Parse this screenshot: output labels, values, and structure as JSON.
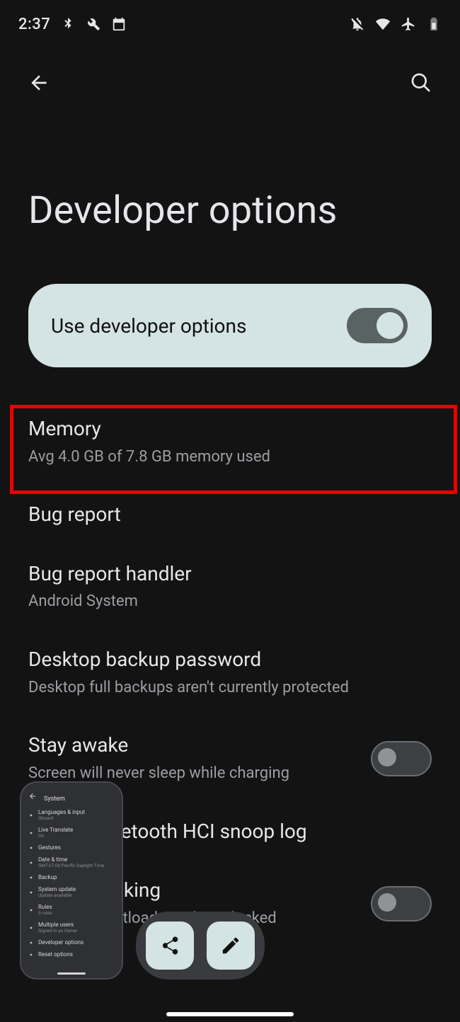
{
  "status": {
    "time": "2:37"
  },
  "page": {
    "title": "Developer options"
  },
  "heroToggle": {
    "label": "Use developer options",
    "on": true
  },
  "settings": [
    {
      "title": "Memory",
      "subtitle": "Avg 4.0 GB of 7.8 GB memory used",
      "highlight": true
    },
    {
      "title": "Bug report"
    },
    {
      "title": "Bug report handler",
      "subtitle": "Android System"
    },
    {
      "title": "Desktop backup password",
      "subtitle": "Desktop full backups aren't currently protected"
    },
    {
      "title": "Stay awake",
      "subtitle": "Screen will never sleep while charging",
      "toggle": false
    },
    {
      "title": "Enable Bluetooth HCI snoop log"
    },
    {
      "title": "OEM unlocking",
      "subtitle": "Allow the bootloader to be unlocked",
      "toggle": false
    }
  ],
  "previewThumb": {
    "header": "System",
    "rows": [
      {
        "title": "Languages & input",
        "sub": "Gboard"
      },
      {
        "title": "Live Translate",
        "sub": "On"
      },
      {
        "title": "Gestures"
      },
      {
        "title": "Date & time",
        "sub": "GMT-07:00 Pacific Daylight Time"
      },
      {
        "title": "Backup"
      },
      {
        "title": "System update",
        "sub": "Update available"
      },
      {
        "title": "Rules",
        "sub": "0 rules"
      },
      {
        "title": "Multiple users",
        "sub": "Signed in as Owner"
      },
      {
        "title": "Developer options"
      },
      {
        "title": "Reset options"
      }
    ]
  }
}
